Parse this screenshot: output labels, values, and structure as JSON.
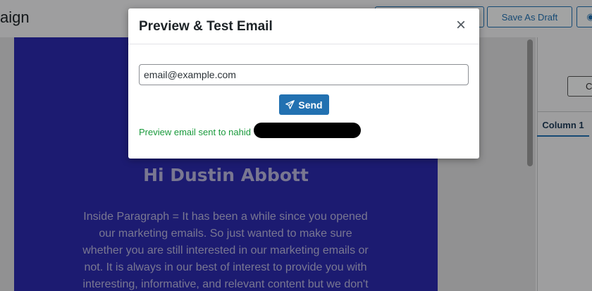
{
  "page": {
    "title": "aign"
  },
  "toolbar": {
    "draft_label": "Save As Draft",
    "preview_label": "◉"
  },
  "email": {
    "greeting": "Hi Dustin Abbott",
    "paragraph": "Inside Paragraph = It has been a while since you opened our marketing emails. So just wanted to make sure whether you are still interested in our marketing emails or not. It is always in our best of interest to provide you with interesting, informative, and relevant content but we don't"
  },
  "right_panel": {
    "button_label": "C",
    "tab_label": "Column 1"
  },
  "modal": {
    "title": "Preview & Test Email",
    "close_label": "×",
    "email_value": "email@example.com",
    "send_label": "Send",
    "status": "Preview email sent to nahid"
  },
  "colors": {
    "accent": "#2271b1",
    "success": "#1a9a3c",
    "email_bg": "#2b29ac"
  }
}
